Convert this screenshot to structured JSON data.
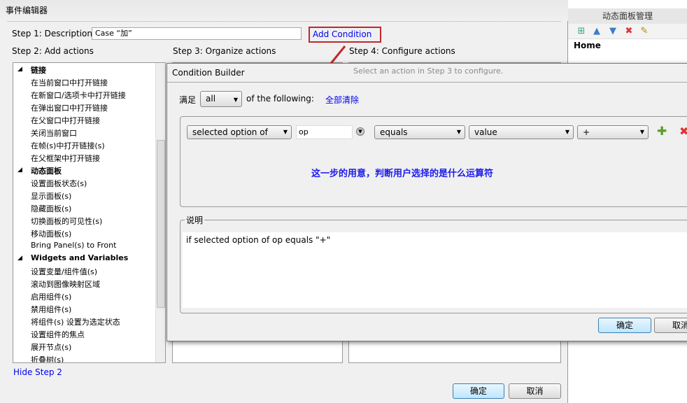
{
  "window": {
    "title": "事件编辑器"
  },
  "right_panel": {
    "title": "动态面板管理",
    "tree_item": "Home"
  },
  "step1": {
    "label": "Step 1: Description",
    "value": "Case “加”",
    "add_condition": "Add Condition"
  },
  "step2": {
    "label": "Step 2: Add actions",
    "hide": "Hide Step 2",
    "items": [
      {
        "label": "链接",
        "group": true
      },
      {
        "label": "在当前窗口中打开链接"
      },
      {
        "label": "在新窗口/选项卡中打开链接"
      },
      {
        "label": "在弹出窗口中打开链接"
      },
      {
        "label": "在父窗口中打开链接"
      },
      {
        "label": "关闭当前窗口"
      },
      {
        "label": "在帧(s)中打开链接(s)"
      },
      {
        "label": "在父框架中打开链接"
      },
      {
        "label": "动态面板",
        "group": true
      },
      {
        "label": "设置面板状态(s)"
      },
      {
        "label": "显示面板(s)"
      },
      {
        "label": "隐藏面板(s)"
      },
      {
        "label": "切换面板的可见性(s)"
      },
      {
        "label": "移动面板(s)"
      },
      {
        "label": "Bring Panel(s) to Front"
      },
      {
        "label": "Widgets and Variables",
        "group": true
      },
      {
        "label": "设置变量/组件值(s)"
      },
      {
        "label": "滚动到图像映射区域"
      },
      {
        "label": "启用组件(s)"
      },
      {
        "label": "禁用组件(s)"
      },
      {
        "label": "将组件(s) 设置为选定状态"
      },
      {
        "label": "设置组件的焦点"
      },
      {
        "label": "展开节点(s)"
      },
      {
        "label": "折叠树(s)"
      }
    ]
  },
  "step3": {
    "label": "Step 3: Organize actions"
  },
  "step4": {
    "label": "Step 4: Configure actions",
    "hint": "Select an action in Step 3 to configure."
  },
  "footer": {
    "ok": "确定",
    "cancel": "取消"
  },
  "condition_builder": {
    "title": "Condition Builder",
    "satisfy": "满足",
    "match": "all",
    "of_following": "of the following:",
    "clear_all": "全部清除",
    "row": {
      "type": "selected option of",
      "target": "op",
      "operator": "equals",
      "value_type": "value",
      "value": "+"
    },
    "annotation": "这一步的用意，判断用户选择的是什么运算符",
    "desc_label": "说明",
    "desc": "if selected option of op equals \"+\"",
    "ok": "确定",
    "cancel": "取消"
  }
}
